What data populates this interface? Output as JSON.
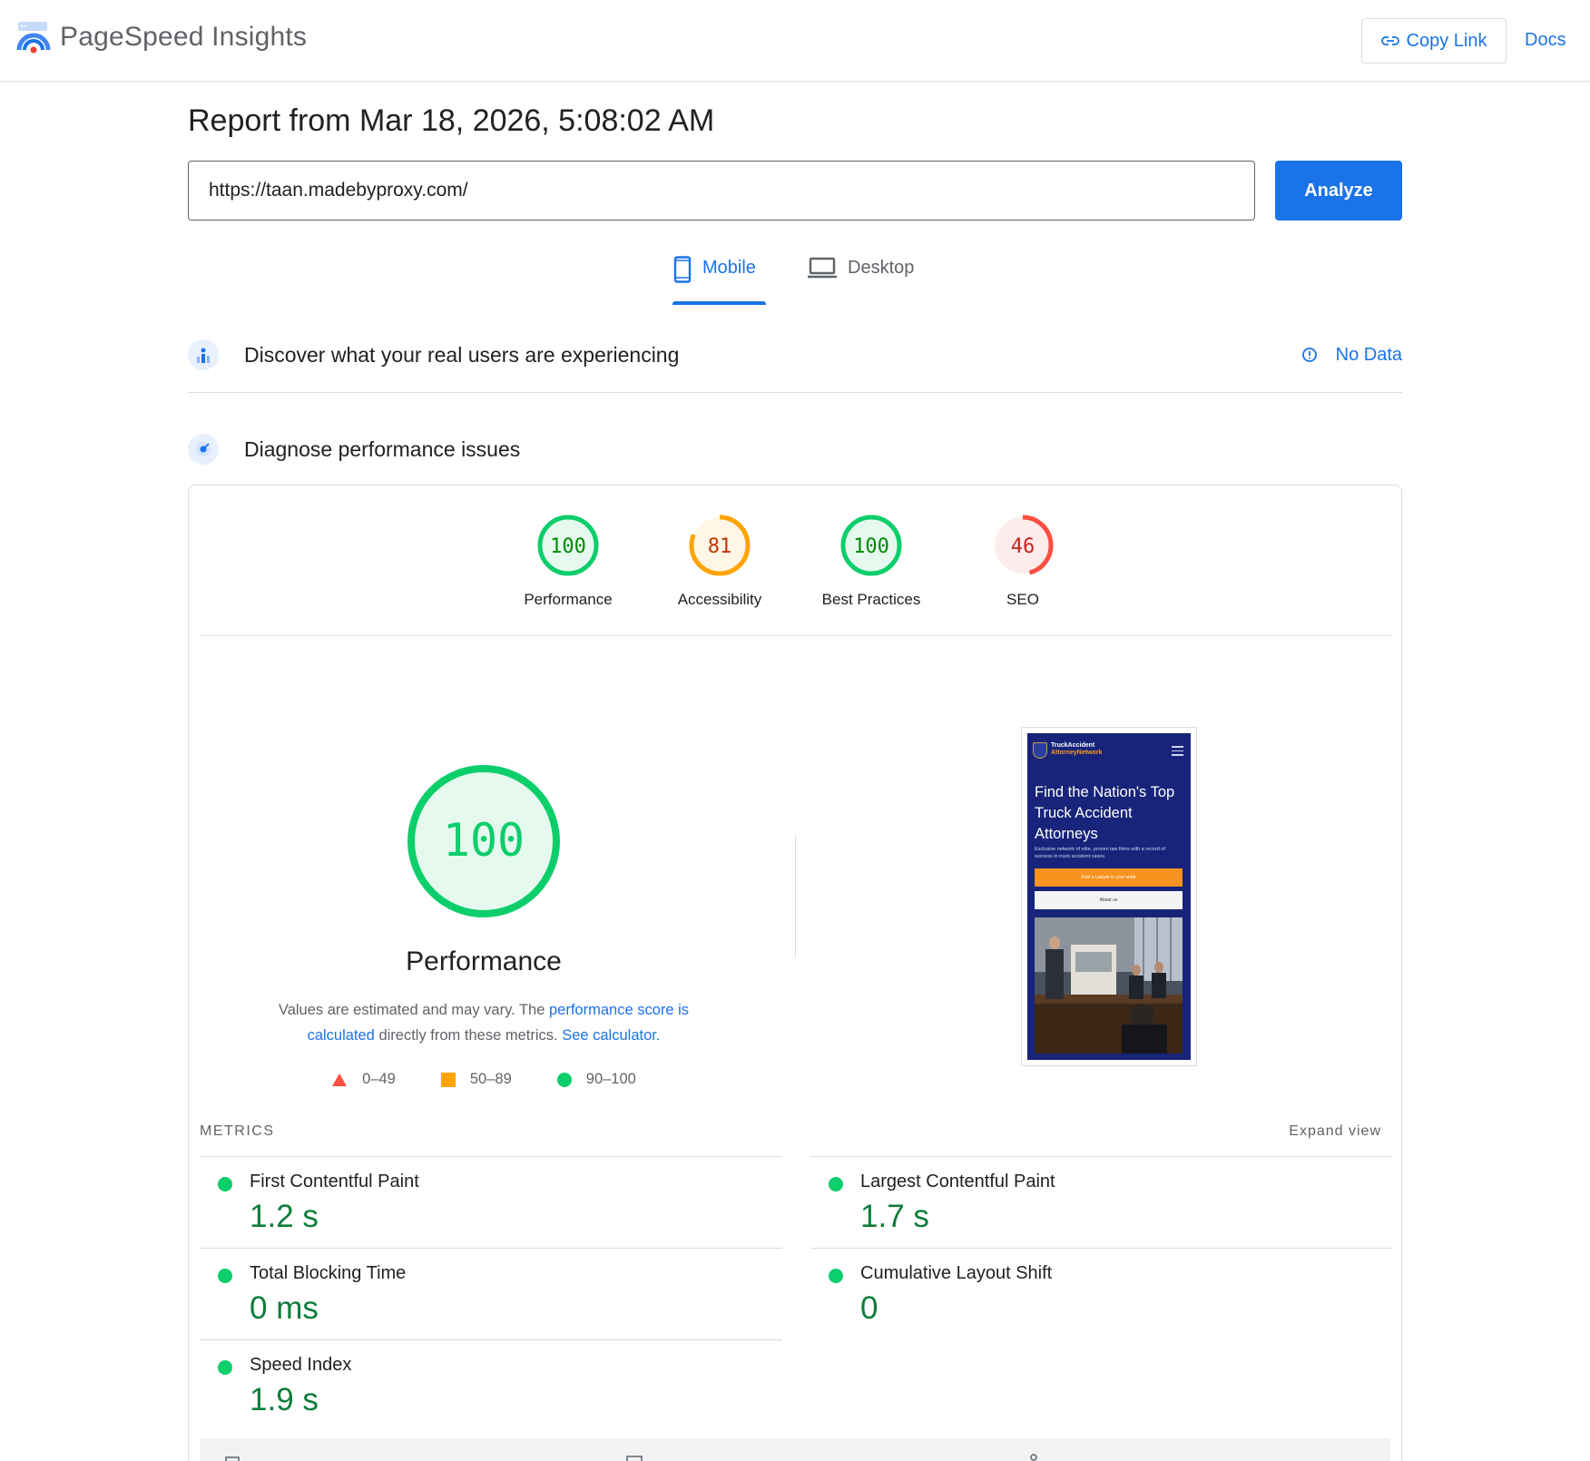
{
  "app": {
    "title": "PageSpeed Insights",
    "copy_link_label": "Copy Link",
    "docs_label": "Docs"
  },
  "report": {
    "title": "Report from Mar 18, 2026, 5:08:02 AM",
    "url_value": "https://taan.madebyproxy.com/",
    "analyze_label": "Analyze"
  },
  "tabs": [
    {
      "label": "Mobile",
      "icon": "phone-icon",
      "selected": true
    },
    {
      "label": "Desktop",
      "icon": "laptop-icon",
      "selected": false
    }
  ],
  "crux": {
    "title": "Discover what your real users are experiencing",
    "status": "No Data"
  },
  "diagnose": {
    "title": "Diagnose performance issues"
  },
  "scores": [
    {
      "label": "Performance",
      "value": "100",
      "fraction": 1.0,
      "color": "#0cce6b",
      "text_color": "#008800",
      "bg": "#e6f9ef"
    },
    {
      "label": "Accessibility",
      "value": "81",
      "fraction": 0.81,
      "color": "#ffa400",
      "text_color": "#c33300",
      "bg": "#fff6e6"
    },
    {
      "label": "Best Practices",
      "value": "100",
      "fraction": 1.0,
      "color": "#0cce6b",
      "text_color": "#008800",
      "bg": "#e6f9ef"
    },
    {
      "label": "SEO",
      "value": "46",
      "fraction": 0.46,
      "color": "#ff4e42",
      "text_color": "#c7221f",
      "bg": "#fdeceb"
    }
  ],
  "performance": {
    "score": "100",
    "fraction": 1.0,
    "label": "Performance",
    "desc_prefix": "Values are estimated and may vary. The ",
    "desc_link1": "performance score is calculated",
    "desc_middle": " directly from these metrics. ",
    "desc_link2": "See calculator."
  },
  "legend": [
    {
      "range": "0–49",
      "shape": "triangle",
      "color": "#ff4e42"
    },
    {
      "range": "50–89",
      "shape": "square",
      "color": "#ffa400"
    },
    {
      "range": "90–100",
      "shape": "circle",
      "color": "#0cce6b"
    }
  ],
  "thumbnail": {
    "brand_line1": "TruckAccident",
    "brand_line2": "AttorneyNetwork",
    "headline": "Find the Nation's Top Truck Accident Attorneys",
    "subtext": "Exclusive network of elite, proven law firms with a record of success in truck accident cases.",
    "button1": "Find a Lawyer in your state",
    "button2": "About us"
  },
  "metrics": {
    "label": "METRICS",
    "expand_label": "Expand view",
    "items": [
      {
        "title": "First Contentful Paint",
        "value": "1.2 s",
        "status": "good"
      },
      {
        "title": "Largest Contentful Paint",
        "value": "1.7 s",
        "status": "good"
      },
      {
        "title": "Total Blocking Time",
        "value": "0 ms",
        "status": "good"
      },
      {
        "title": "Cumulative Layout Shift",
        "value": "0",
        "status": "good"
      },
      {
        "title": "Speed Index",
        "value": "1.9 s",
        "status": "good"
      }
    ]
  }
}
